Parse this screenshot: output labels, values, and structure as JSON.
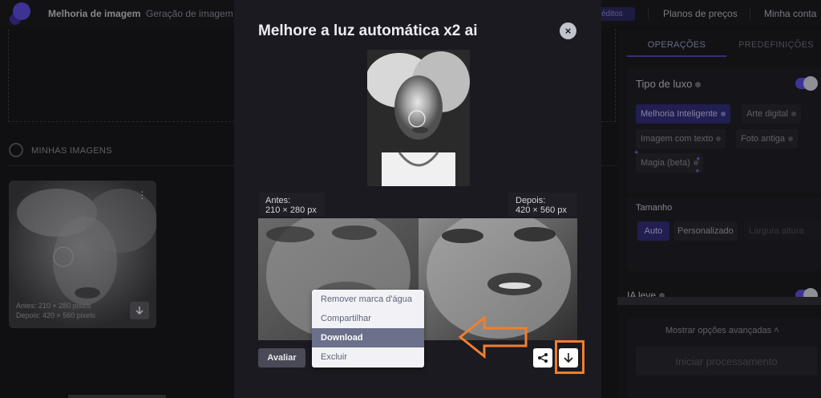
{
  "topbar": {
    "nav_enhance": "Melhoria de imagem",
    "nav_generate": "Geração de imagem",
    "credits": "éditos",
    "nav_pricing": "Planos de preços",
    "nav_account": "Minha conta"
  },
  "workspace": {
    "my_images_title": "MINHAS IMAGENS",
    "card_before": "Antes:  210 × 280 pixels",
    "card_after": "Depois: 420 × 560 pixels"
  },
  "right_panel": {
    "tabs": [
      "OPERAÇÕES",
      "PREDEFINIÇÕES"
    ],
    "luxury_type_label": "Tipo de luxo",
    "chips": [
      "Melhoria Inteligente",
      "Arte digital",
      "Imagem com texto",
      "Foto antiga",
      "Magia (beta)"
    ],
    "size_label": "Tamanho",
    "size_auto": "Auto",
    "size_custom": "Personalizado",
    "size_width_placeholder": "Largura altura",
    "ia_light_label": "IA leve",
    "advanced_label": "Mostrar opções avançadas",
    "start_button": "Iniciar processamento"
  },
  "modal": {
    "title": "Melhore a luz automática x2 ai",
    "before_label": "Antes:",
    "before_size": "210 × 280 px",
    "after_label": "Depois:",
    "after_size": "420 × 560 px",
    "rate_button": "Avaliar",
    "menu": [
      "Remover marca d'água",
      "Compartilhar",
      "Download",
      "Excluir"
    ]
  },
  "colors": {
    "accent": "#5b4be0",
    "highlight": "#f07f2e",
    "menu_selected": "#6b718b"
  }
}
